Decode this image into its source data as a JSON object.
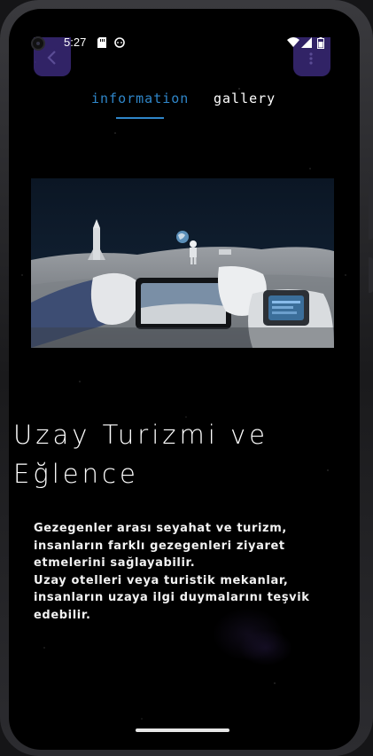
{
  "status_bar": {
    "time": "5:27",
    "icons": [
      "sd-card-icon",
      "face-icon",
      "wifi-icon",
      "signal-icon",
      "battery-icon"
    ]
  },
  "nav": {
    "back_icon": "chevron-left-icon",
    "menu_icon": "more-vert-icon"
  },
  "tabs": [
    {
      "label": "information",
      "active": true
    },
    {
      "label": "gallery",
      "active": false
    }
  ],
  "hero_image": {
    "description_icon": "astronaut-moon-photo"
  },
  "content": {
    "title_line1": "Uzay Turizmi ve",
    "title_line2": "Eğlence",
    "paragraph1": "Gezegenler arası seyahat ve turizm, insanların farklı gezegenleri ziyaret etmelerini sağlayabilir.",
    "paragraph2": "Uzay otelleri veya turistik mekanlar, insanların uzaya ilgi duymalarını teşvik edebilir."
  },
  "colors": {
    "accent": "#2f86c9",
    "nav_button": "#3a2a78",
    "background": "#000000",
    "text": "#ffffff"
  }
}
